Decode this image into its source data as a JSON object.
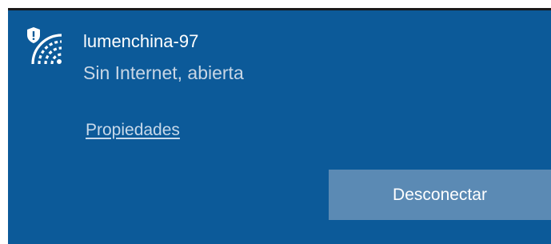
{
  "network": {
    "name": "lumenchina-97",
    "status": "Sin Internet, abierta",
    "icon": "wifi-shield-icon"
  },
  "links": {
    "properties_label": "Propiedades"
  },
  "actions": {
    "disconnect_label": "Desconectar"
  },
  "colors": {
    "panel_background": "#0c5a99",
    "button_background": "#5b8ab4",
    "text_primary": "#ffffff",
    "text_secondary": "#c8d6e5"
  }
}
